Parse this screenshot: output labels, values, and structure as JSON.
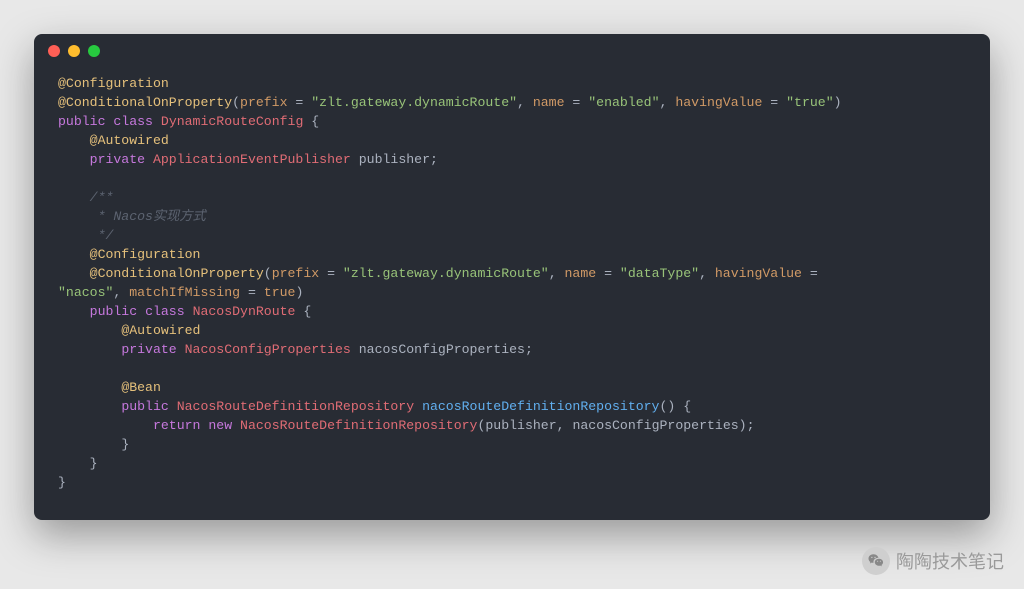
{
  "window": {
    "title": ""
  },
  "watermark": {
    "text": "陶陶技术笔记",
    "icon": "wechat-icon"
  },
  "code": {
    "tokens": {
      "ann_Configuration": "@Configuration",
      "ann_ConditionalOnProperty": "@ConditionalOnProperty",
      "ann_Autowired": "@Autowired",
      "ann_Bean": "@Bean",
      "attr_prefix": "prefix",
      "attr_name": "name",
      "attr_havingValue": "havingValue",
      "attr_matchIfMissing": "matchIfMissing",
      "str_zlt": "\"zlt.gateway.dynamicRoute\"",
      "str_enabled": "\"enabled\"",
      "str_true": "\"true\"",
      "str_dataType": "\"dataType\"",
      "str_nacos": "\"nacos\"",
      "kw_public": "public",
      "kw_private": "private",
      "kw_class": "class",
      "kw_return": "return",
      "kw_new": "new",
      "bool_true": "true",
      "cls_DynamicRouteConfig": "DynamicRouteConfig",
      "cls_ApplicationEventPublisher": "ApplicationEventPublisher",
      "cls_NacosDynRoute": "NacosDynRoute",
      "cls_NacosConfigProperties": "NacosConfigProperties",
      "cls_NacosRouteDefinitionRepository": "NacosRouteDefinitionRepository",
      "var_publisher": "publisher",
      "var_nacosConfigProperties": "nacosConfigProperties",
      "fn_nacosRouteDefinitionRepository": "nacosRouteDefinitionRepository",
      "cmt1": "/**",
      "cmt2": " * Nacos实现方式",
      "cmt3": " */",
      "punc_open": "(",
      "punc_close": ")",
      "punc_eq": " = ",
      "punc_comma": ", ",
      "punc_obrace": " {",
      "punc_cbrace": "}",
      "punc_semi": ";",
      "punc_sp": " "
    }
  }
}
